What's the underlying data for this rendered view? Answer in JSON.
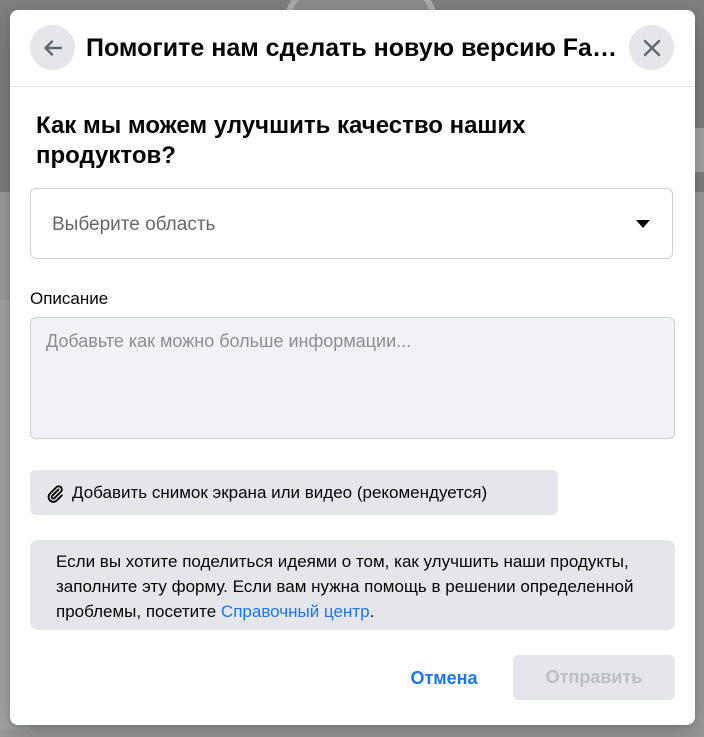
{
  "dialog": {
    "title": "Помогите нам сделать новую версию Facebook лучше",
    "question": "Как мы можем улучшить качество наших продуктов?",
    "area_select": {
      "placeholder": "Выберите область"
    },
    "description": {
      "label": "Описание",
      "placeholder": "Добавьте как можно больше информации...",
      "value": ""
    },
    "attach_button_label": "Добавить снимок экрана или видео (рекомендуется)",
    "info": {
      "text": "Если вы хотите поделиться идеями о том, как улучшить наши продукты, заполните эту форму. Если вам нужна помощь в решении определенной проблемы, посетите ",
      "link_label": "Справочный центр",
      "suffix": "."
    },
    "buttons": {
      "cancel_label": "Отмена",
      "submit_label": "Отправить"
    }
  },
  "icons": {
    "back": "arrow-left-icon",
    "close": "close-icon",
    "select_caret": "caret-down-icon",
    "attach": "paperclip-icon"
  },
  "colors": {
    "accent": "#1877f2",
    "button_gray": "#e4e6eb",
    "text_primary": "#050505",
    "text_secondary": "#65676b",
    "disabled_text": "#bcc0c4"
  }
}
